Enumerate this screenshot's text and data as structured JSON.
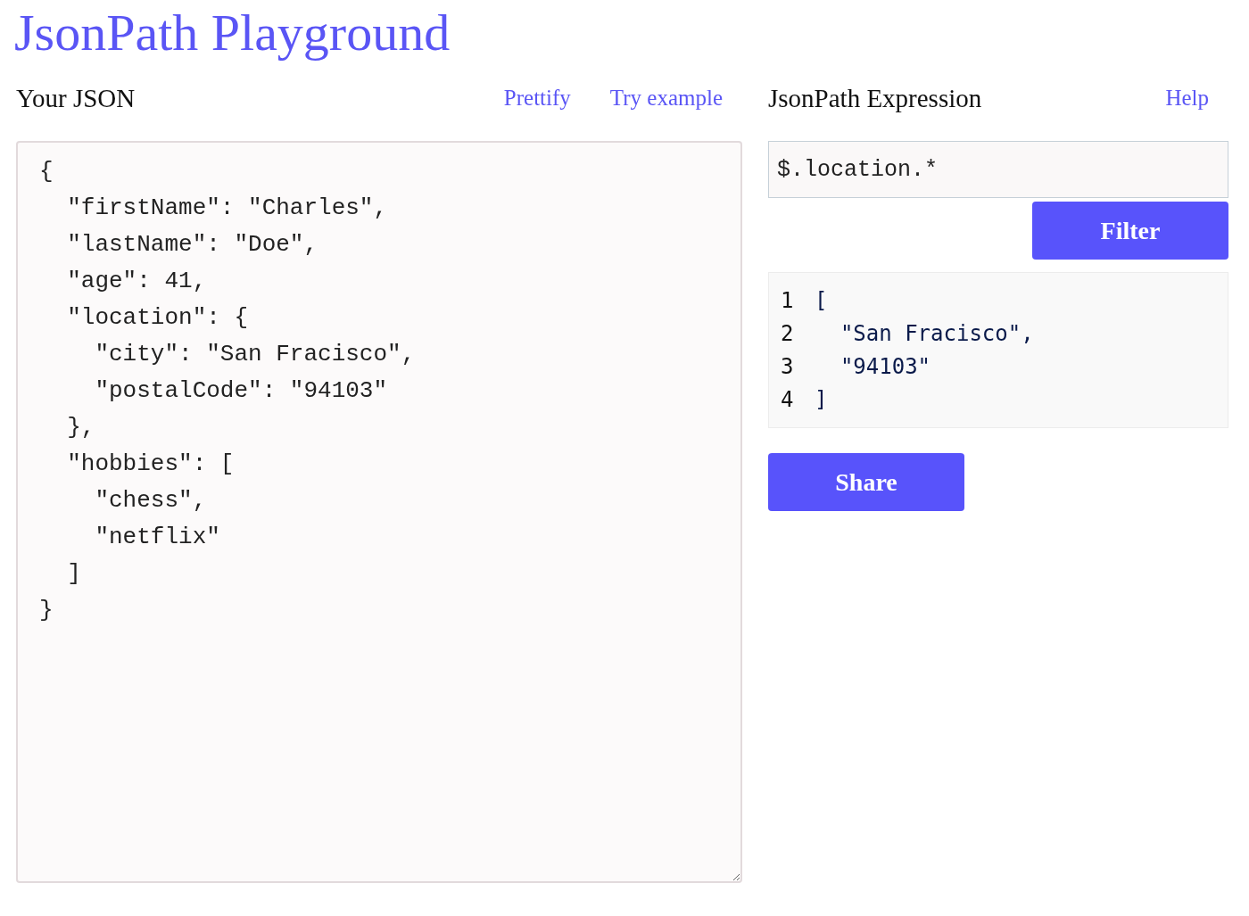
{
  "title": "JsonPath Playground",
  "json_panel": {
    "heading": "Your JSON",
    "links": [
      "Prettify",
      "Try example"
    ],
    "editor_lines": [
      "{",
      "  \"firstName\": \"Charles\",",
      "  \"lastName\": \"Doe\",",
      "  \"age\": 41,",
      "  \"location\": {",
      "    \"city\": \"San Fracisco\",",
      "    \"postalCode\": \"94103\"",
      "  },",
      "  \"hobbies\": [",
      "    \"chess\",",
      "    \"netflix\"",
      "  ]",
      "}"
    ]
  },
  "expression_panel": {
    "heading": "JsonPath Expression",
    "help_link": "Help",
    "expression": "$.location.*",
    "filter_button": "Filter",
    "result_lines": [
      {
        "number": "1",
        "text": "["
      },
      {
        "number": "2",
        "text": "  \"San Fracisco\","
      },
      {
        "number": "3",
        "text": "  \"94103\""
      },
      {
        "number": "4",
        "text": "]"
      }
    ],
    "share_button": "Share"
  }
}
